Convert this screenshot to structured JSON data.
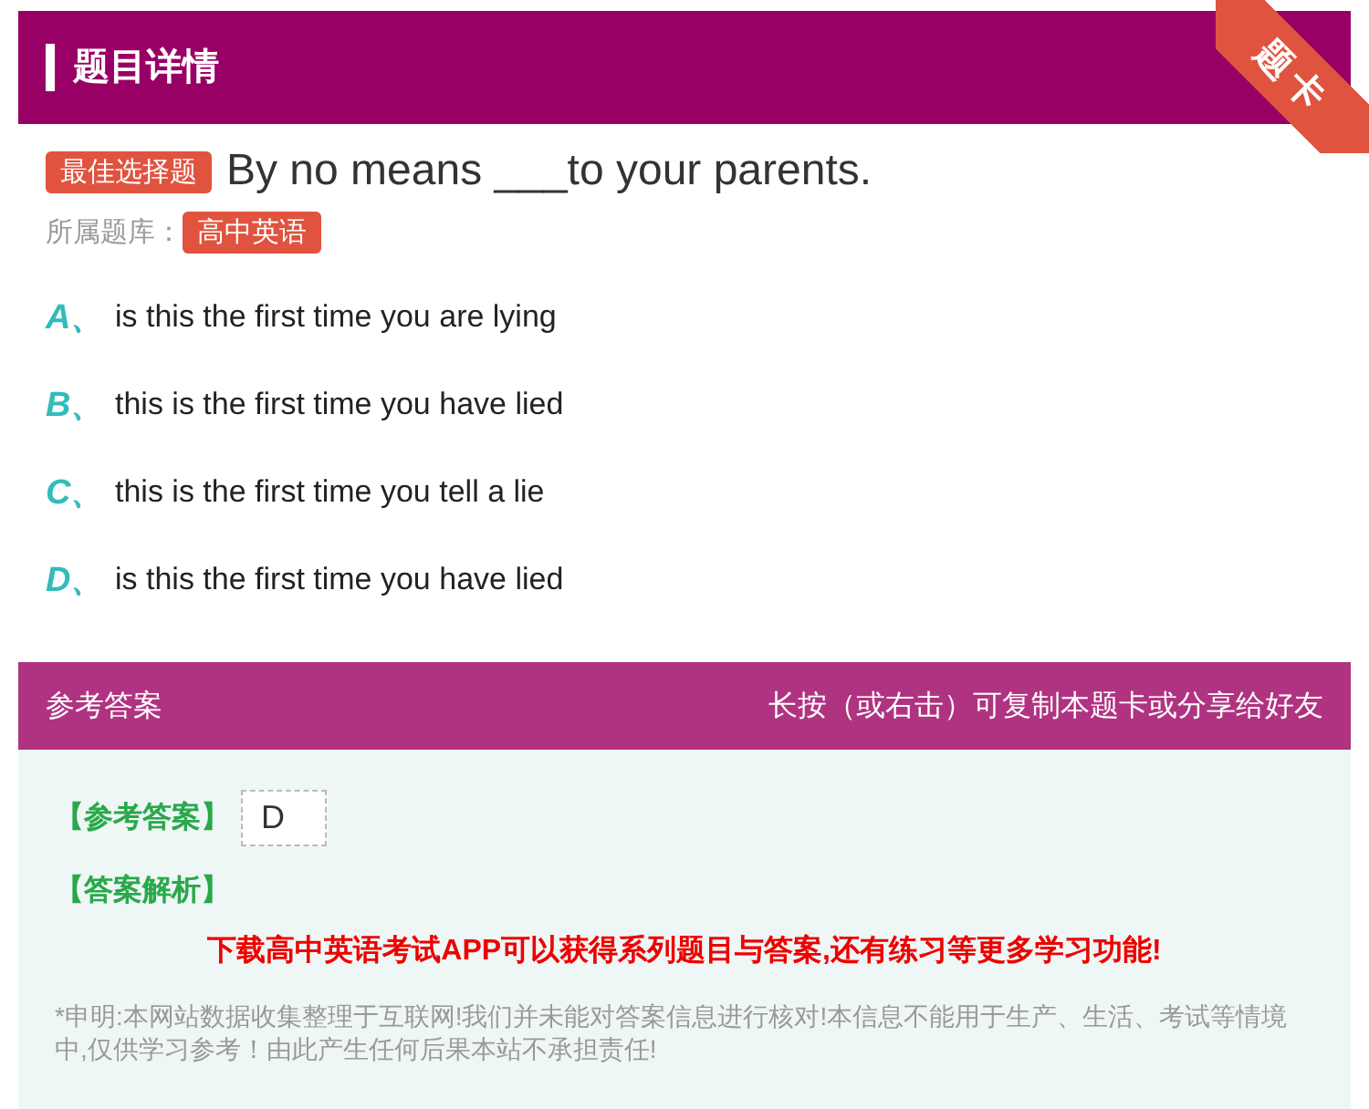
{
  "header": {
    "title": "题目详情",
    "ribbon": "题卡"
  },
  "question": {
    "type_tag": "最佳选择题",
    "text": "By no means ___to your parents.",
    "bank_label": "所属题库：",
    "bank": "高中英语"
  },
  "options": [
    {
      "letter": "A、",
      "text": "is this the first time you are lying"
    },
    {
      "letter": "B、",
      "text": "this is the first time you have lied"
    },
    {
      "letter": "C、",
      "text": "this is the first time you tell a lie"
    },
    {
      "letter": "D、",
      "text": "is this the first time you have lied"
    }
  ],
  "answer_bar": {
    "title": "参考答案",
    "hint": "长按（或右击）可复制本题卡或分享给好友"
  },
  "answer": {
    "answer_label": "【参考答案】",
    "answer_value": "D",
    "analysis_label": "【答案解析】",
    "promo": "下载高中英语考试APP可以获得系列题目与答案,还有练习等更多学习功能!",
    "disclaimer": "*申明:本网站数据收集整理于互联网!我们并未能对答案信息进行核对!本信息不能用于生产、生活、考试等情境中,仅供学习参考！由此产生任何后果本站不承担责任!"
  }
}
